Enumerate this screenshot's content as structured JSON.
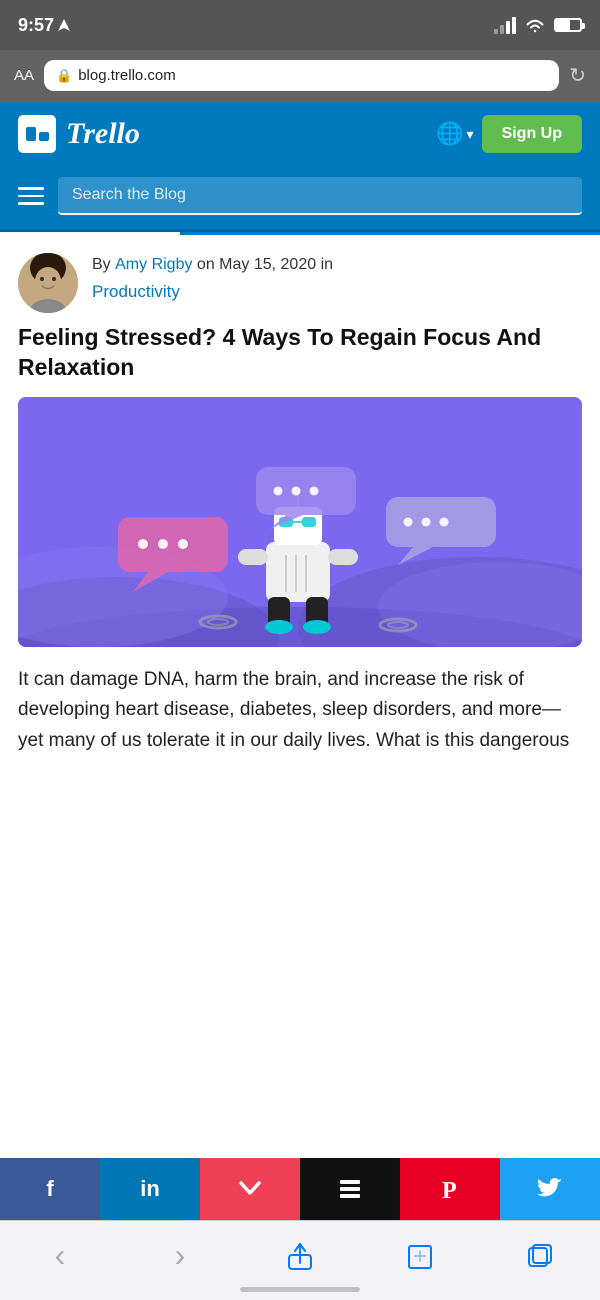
{
  "statusBar": {
    "time": "9:57",
    "url": "blog.trello.com"
  },
  "browserBar": {
    "aa": "AA",
    "url": "blog.trello.com",
    "refreshIcon": "↻"
  },
  "header": {
    "logoAlt": "Trello",
    "wordmark": "Trello",
    "signupLabel": "Sign Up"
  },
  "searchBar": {
    "placeholder": "Search the Blog"
  },
  "article": {
    "byPrefix": "By ",
    "authorName": "Amy Rigby",
    "byMiddle": " on May 15, 2020 in",
    "categoryName": "Productivity",
    "title": "Feeling Stressed? 4 Ways To Regain Focus And Relaxation",
    "bodyText": "It can damage DNA, harm the brain, and increase the risk of developing heart disease, diabetes, sleep disorders, and more—yet many of us tolerate it in our daily lives. What is this dangerous"
  },
  "shareBar": {
    "facebook": "f",
    "linkedin": "in",
    "pocket": "P",
    "buffer": "≡",
    "pinterest": "P",
    "twitter": "t"
  },
  "browserNav": {
    "back": "‹",
    "forward": "›",
    "share": "↑",
    "bookmarks": "□",
    "tabs": "⧉"
  }
}
